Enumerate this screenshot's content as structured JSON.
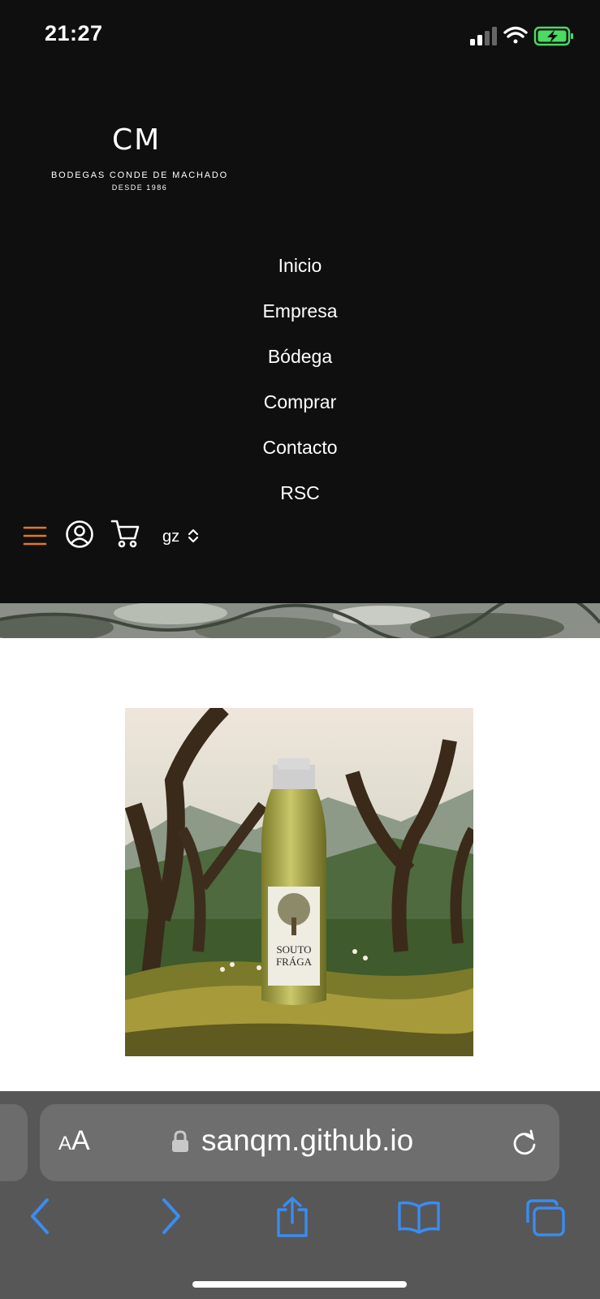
{
  "status": {
    "time": "21:27"
  },
  "logo": {
    "mark": "CM",
    "name": "BODEGAS CONDE DE MACHADO",
    "since": "DESDE 1986"
  },
  "nav": {
    "items": [
      {
        "label": "Inicio"
      },
      {
        "label": "Empresa"
      },
      {
        "label": "Bódega"
      },
      {
        "label": "Comprar"
      },
      {
        "label": "Contacto"
      },
      {
        "label": "RSC"
      }
    ]
  },
  "toolbar": {
    "language": "gz",
    "icons": [
      "menu-icon",
      "user-icon",
      "cart-icon",
      "updown-chevron-icon"
    ],
    "accent_color": "#e07a1f"
  },
  "product": {
    "label_line1": "SOUTO",
    "label_line2": "FRÁGA"
  },
  "browser": {
    "text_size_label": "AA",
    "url": "sanqm.github.io",
    "accent_color": "#3a8cf0",
    "icons": [
      "back-icon",
      "forward-icon",
      "share-icon",
      "bookmarks-icon",
      "tabs-icon"
    ]
  }
}
